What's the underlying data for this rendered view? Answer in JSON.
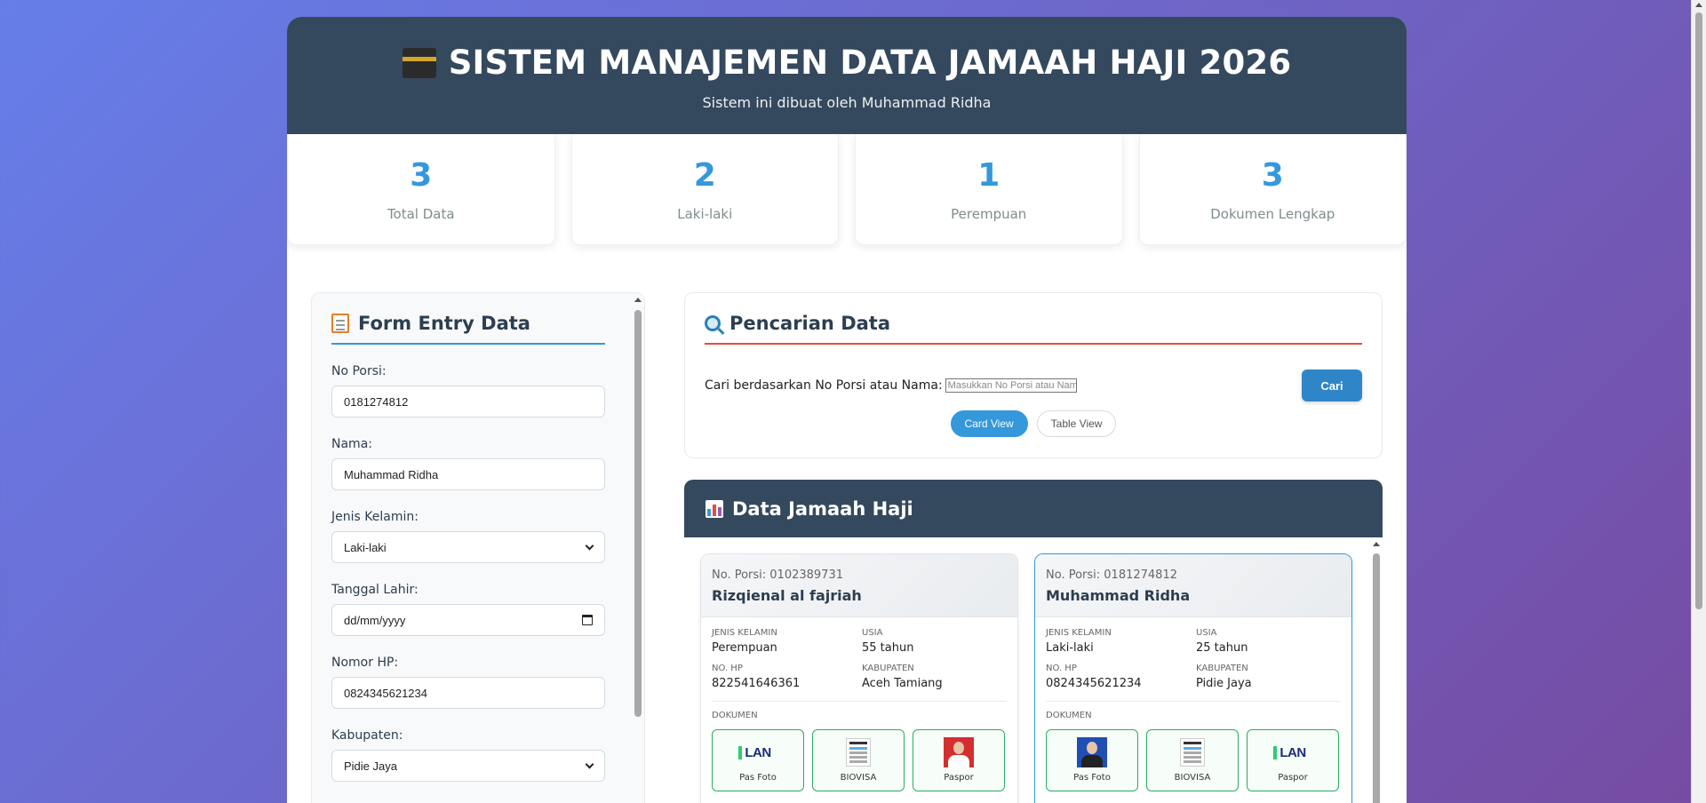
{
  "header": {
    "title": "SISTEM MANAJEMEN DATA JAMAAH HAJI 2026",
    "subtitle": "Sistem ini dibuat oleh Muhammad Ridha"
  },
  "stats": [
    {
      "value": "3",
      "label": "Total Data"
    },
    {
      "value": "2",
      "label": "Laki-laki"
    },
    {
      "value": "1",
      "label": "Perempuan"
    },
    {
      "value": "3",
      "label": "Dokumen Lengkap"
    }
  ],
  "form": {
    "title": "Form Entry Data",
    "fields": {
      "no_porsi": {
        "label": "No Porsi:",
        "value": "0181274812"
      },
      "nama": {
        "label": "Nama:",
        "value": "Muhammad Ridha"
      },
      "jenis_kelamin": {
        "label": "Jenis Kelamin:",
        "value": "Laki-laki"
      },
      "tanggal_lahir": {
        "label": "Tanggal Lahir:",
        "value": "dd/mm/yyyy"
      },
      "nomor_hp": {
        "label": "Nomor HP:",
        "value": "0824345621234"
      },
      "kabupaten": {
        "label": "Kabupaten:",
        "value": "Pidie Jaya"
      }
    }
  },
  "search": {
    "title": "Pencarian Data",
    "label": "Cari berdasarkan No Porsi atau Nama:",
    "placeholder": "Masukkan No Porsi atau Nama",
    "button": "Cari",
    "views": {
      "card": "Card View",
      "table": "Table View"
    },
    "active_view": "card"
  },
  "data": {
    "title": "Data Jamaah Haji",
    "labels": {
      "jenis_kelamin": "JENIS KELAMIN",
      "usia": "USIA",
      "no_hp": "NO. HP",
      "kabupaten": "KABUPATEN",
      "dokumen": "DOKUMEN"
    },
    "records": [
      {
        "porsi": "No. Porsi: 0102389731",
        "nama": "Rizqienal al fajriah",
        "jenis_kelamin": "Perempuan",
        "usia": "55 tahun",
        "no_hp": "822541646361",
        "kabupaten": "Aceh Tamiang",
        "docs": [
          "Pas Foto",
          "BIOVISA",
          "Paspor"
        ]
      },
      {
        "porsi": "No. Porsi: 0181274812",
        "nama": "Muhammad Ridha",
        "jenis_kelamin": "Laki-laki",
        "usia": "25 tahun",
        "no_hp": "0824345621234",
        "kabupaten": "Pidie Jaya",
        "docs": [
          "Pas Foto",
          "BIOVISA",
          "Paspor"
        ]
      }
    ]
  },
  "colors": {
    "accent": "#3498db",
    "header_bg": "#34495e",
    "search_rule": "#e74c3c",
    "doc_border": "#27ae60"
  },
  "icons": {
    "header": "kaaba-icon",
    "form": "memo-icon",
    "search": "magnifier-icon",
    "data": "bar-chart-icon"
  }
}
